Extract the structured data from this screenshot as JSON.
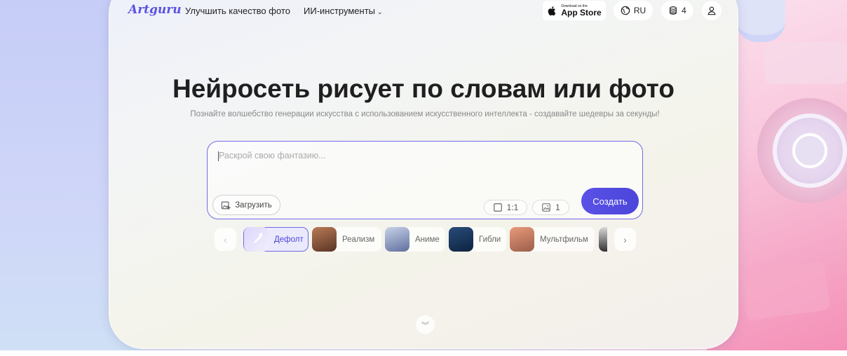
{
  "nav": {
    "logo": "Artguru",
    "links": [
      "Улучшить качество фото",
      "ИИ-инструменты"
    ],
    "appstore_small": "Download on the",
    "appstore_big": "App Store",
    "language": "RU",
    "credits": "4"
  },
  "hero": {
    "title": "Нейросеть рисует по словам или фото",
    "subtitle": "Познайте волшебство генерации искусства с использованием искусственного интеллекта - создавайте шедевры за секунды!"
  },
  "prompt": {
    "placeholder": "Раскрой свою фантазию...",
    "upload_label": "Загрузить",
    "ratio": "1:1",
    "count": "1",
    "create_label": "Создать"
  },
  "styles": [
    {
      "label": "Дефолт",
      "active": true
    },
    {
      "label": "Реализм",
      "active": false
    },
    {
      "label": "Аниме",
      "active": false
    },
    {
      "label": "Гибли",
      "active": false
    },
    {
      "label": "Мультфильм",
      "active": false
    }
  ],
  "colors": {
    "accent": "#5a52e6",
    "logo": "#5a54e0"
  }
}
